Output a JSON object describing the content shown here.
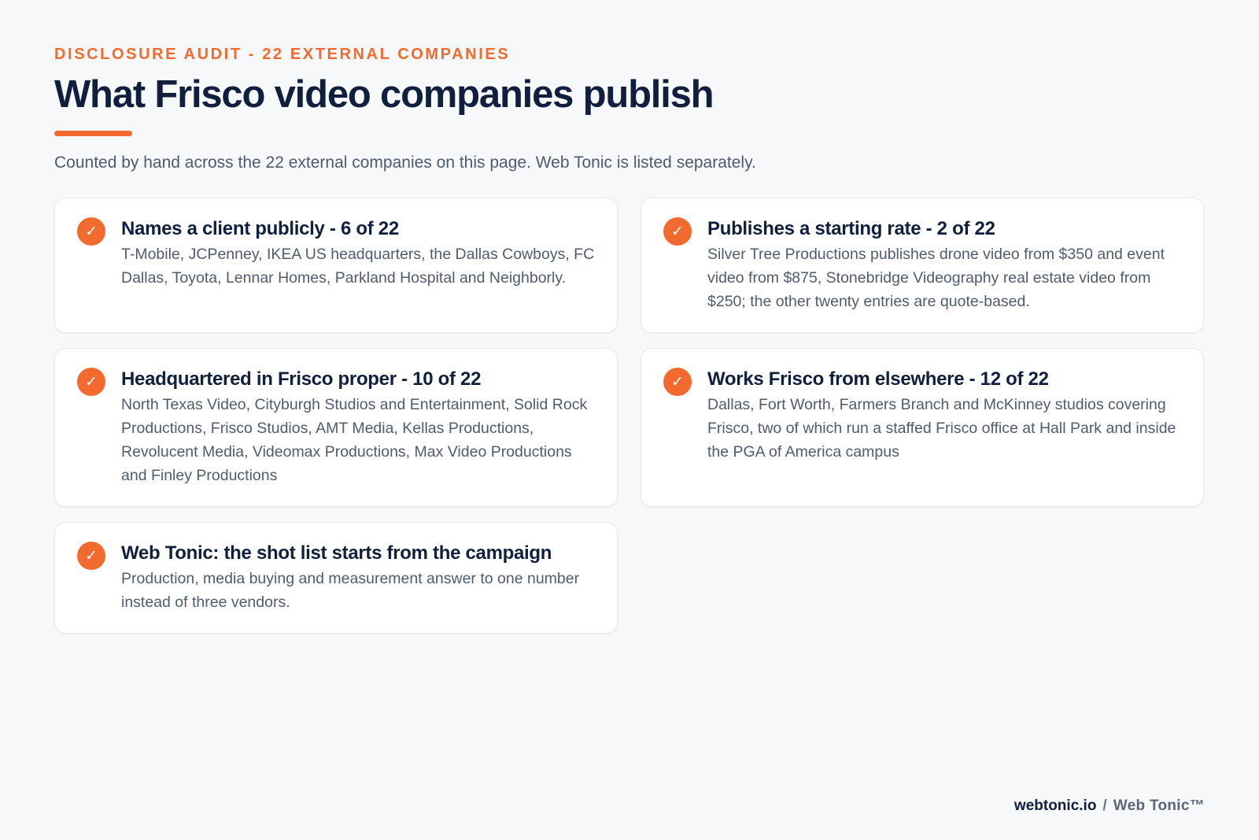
{
  "header": {
    "eyebrow": "DISCLOSURE AUDIT - 22 EXTERNAL COMPANIES",
    "title": "What Frisco video companies publish",
    "subtitle": "Counted by hand across the 22 external companies on this page. Web Tonic is listed separately."
  },
  "cards": [
    {
      "title": "Names a client publicly - 6 of 22",
      "body": "T-Mobile, JCPenney, IKEA US headquarters, the Dallas Cowboys, FC Dallas, Toyota, Lennar Homes, Parkland Hospital and Neighborly."
    },
    {
      "title": "Publishes a starting rate - 2 of 22",
      "body": "Silver Tree Productions publishes drone video from $350 and event video from $875, Stonebridge Videography real estate video from $250; the other twenty entries are quote-based."
    },
    {
      "title": "Headquartered in Frisco proper - 10 of 22",
      "body": "North Texas Video, Cityburgh Studios and Entertainment, Solid Rock Productions, Frisco Studios, AMT Media, Kellas Productions, Revolucent Media, Videomax Productions, Max Video Productions and Finley Productions"
    },
    {
      "title": "Works Frisco from elsewhere - 12 of 22",
      "body": "Dallas, Fort Worth, Farmers Branch and McKinney studios covering Frisco, two of which run a staffed Frisco office at Hall Park and inside the PGA of America campus"
    },
    {
      "title": "Web Tonic: the shot list starts from the campaign",
      "body": "Production, media buying and measurement answer to one number instead of three vendors."
    }
  ],
  "check_glyph": "✓",
  "check_icon": "check-circle-icon",
  "accent_color": "#f26a2e",
  "footer": {
    "domain": "webtonic.io",
    "separator": "/",
    "brand": "Web Tonic™"
  }
}
